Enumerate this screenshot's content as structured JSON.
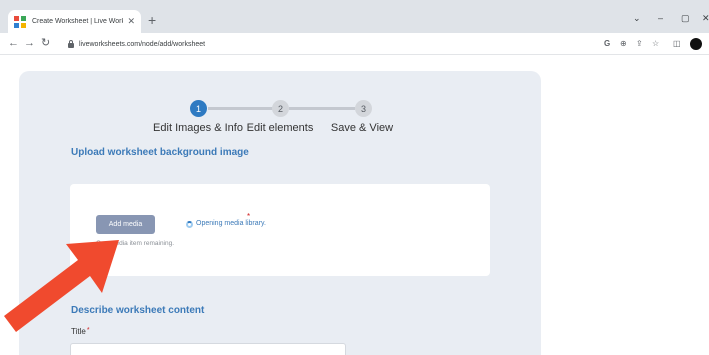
{
  "browser": {
    "tab_title": "Create Worksheet | Live Workshe",
    "url": "liveworksheets.com/node/add/worksheet"
  },
  "stepper": {
    "steps": [
      {
        "number": "1",
        "label": "Edit Images & Info",
        "active": true
      },
      {
        "number": "2",
        "label": "Edit elements",
        "active": false
      },
      {
        "number": "3",
        "label": "Save & View",
        "active": false
      }
    ]
  },
  "upload": {
    "heading": "Upload worksheet background image",
    "add_media_label": "Add media",
    "status": "Opening media library.",
    "required_mark": "*",
    "remaining": "One media item remaining."
  },
  "content": {
    "heading": "Describe worksheet content",
    "title_label": "Title",
    "required_mark": "*",
    "title_value": ""
  },
  "colors": {
    "accent": "#2e7ac2",
    "annotation_arrow": "#f04a2e"
  }
}
